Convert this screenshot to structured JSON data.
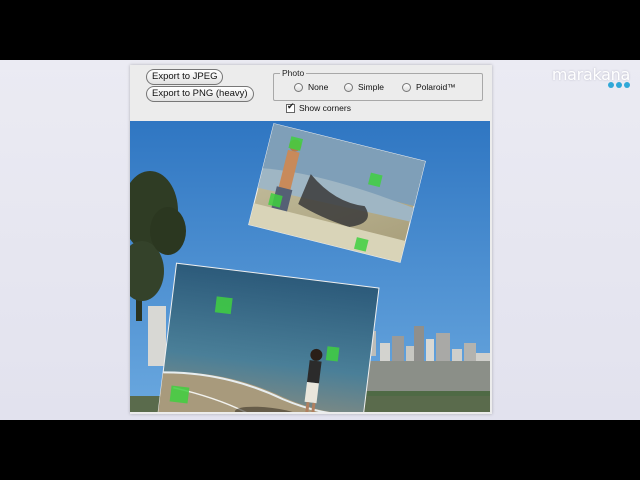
{
  "logo": {
    "text": "marakana"
  },
  "toolbar": {
    "export_jpeg_label": "Export to JPEG",
    "export_png_label": "Export to PNG (heavy)"
  },
  "photo_group": {
    "label": "Photo",
    "options": [
      "None",
      "Simple",
      "Polaroid™"
    ],
    "show_corners_label": "Show corners",
    "show_corners_checked": true
  },
  "colors": {
    "sky": "#3d86cc",
    "corner_marker": "#3fd03f",
    "logo_dots": "#30a8d8"
  }
}
